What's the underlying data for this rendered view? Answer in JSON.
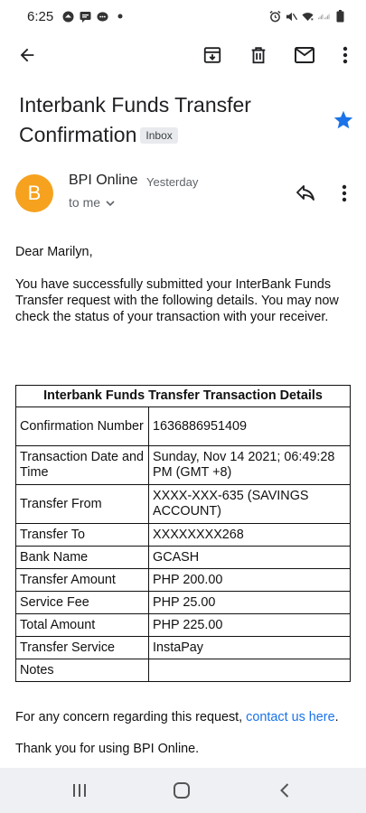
{
  "status_bar": {
    "time": "6:25",
    "icons": [
      "weather-icon",
      "message-icon",
      "chat-icon",
      "dot-icon",
      "alarm-icon",
      "mute-icon",
      "wifi-icon",
      "signal-icon",
      "battery-icon"
    ]
  },
  "toolbar": {
    "icons": [
      "back-arrow-icon",
      "archive-icon",
      "delete-icon",
      "mark-unread-icon",
      "more-vert-icon"
    ]
  },
  "email": {
    "subject": "Interbank Funds Transfer Confirmation",
    "label": "Inbox",
    "starred": true,
    "sender_initial": "B",
    "sender_name": "BPI Online",
    "time": "Yesterday",
    "to": "to me",
    "greeting": "Dear Marilyn,",
    "paragraph": "You have successfully submitted your InterBank Funds Transfer request with the following details. You may now check the status of your transaction with your receiver.",
    "table": {
      "title": "Interbank Funds Transfer Transaction Details",
      "rows": [
        {
          "label": "Confirmation Number",
          "value": "1636886951409"
        },
        {
          "label": "Transaction Date and Time",
          "value": "Sunday, Nov 14 2021; 06:49:28 PM (GMT +8)"
        },
        {
          "label": "Transfer From",
          "value": "XXXX-XXX-635 (SAVINGS ACCOUNT)"
        },
        {
          "label": "Transfer To",
          "value": "XXXXXXXX268"
        },
        {
          "label": "Bank Name",
          "value": "GCASH"
        },
        {
          "label": "Transfer Amount",
          "value": "PHP 200.00"
        },
        {
          "label": "Service Fee",
          "value": "PHP 25.00"
        },
        {
          "label": "Total Amount",
          "value": "PHP 225.00"
        },
        {
          "label": "Transfer Service",
          "value": "InstaPay"
        },
        {
          "label": "Notes",
          "value": ""
        }
      ]
    },
    "concern_text": "For any concern regarding this request,",
    "concern_link": "contact us here",
    "concern_end": ".",
    "thanks": "Thank you for using BPI Online."
  },
  "colors": {
    "avatar": "#f6a21e",
    "star": "#1a73e8",
    "link": "#1a73e8",
    "nav_bar": "#eef0f4"
  },
  "nav": {
    "icons": [
      "recent-apps-icon",
      "home-icon",
      "back-icon"
    ]
  }
}
